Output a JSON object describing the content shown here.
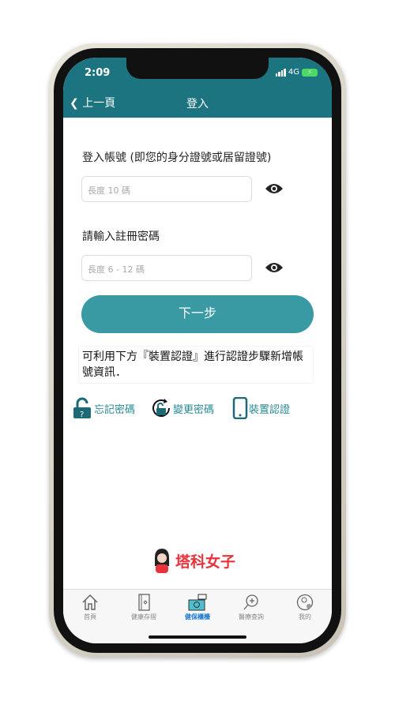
{
  "status": {
    "time": "2:09",
    "network": "4G"
  },
  "nav": {
    "back_label": "上一頁",
    "title": "登入"
  },
  "form": {
    "account_label": "登入帳號 (即您的身分證號或居留證號)",
    "account_placeholder": "長度 10 碼",
    "password_label": "請輸入註冊密碼",
    "password_placeholder": "長度 6 - 12 碼",
    "next_label": "下一步"
  },
  "note": "可利用下方『裝置認證』進行認證步驟新增帳號資訊．",
  "links": [
    {
      "label": "忘記密碼",
      "icon": "unlock-question-icon"
    },
    {
      "label": "變更密碼",
      "icon": "refresh-lock-icon"
    },
    {
      "label": "裝置認證",
      "icon": "phone-icon"
    }
  ],
  "watermark": "塔科女子",
  "tabs": [
    {
      "label": "首頁"
    },
    {
      "label": "健康存摺"
    },
    {
      "label": "健保櫃檯",
      "active": true
    },
    {
      "label": "醫療查詢"
    },
    {
      "label": "我的"
    }
  ],
  "colors": {
    "header": "#1c7480",
    "accent": "#3a9aa3",
    "active_tab": "#1a7bd6"
  }
}
